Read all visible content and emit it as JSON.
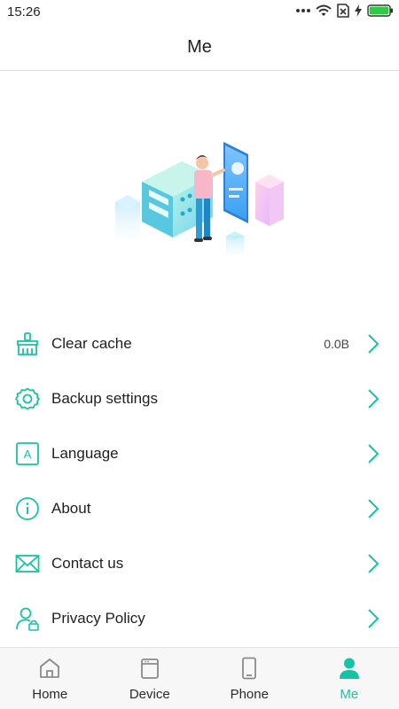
{
  "status_bar": {
    "time": "15:26",
    "icons": [
      "more-dots-icon",
      "wifi-icon",
      "sim-off-icon",
      "charging-icon",
      "battery-icon"
    ]
  },
  "header": {
    "title": "Me"
  },
  "colors": {
    "accent": "#17c3a5",
    "text": "#1f1f1f",
    "divider": "#dcdcdc",
    "nav_background": "#f7f7f7"
  },
  "menu": {
    "items": [
      {
        "label": "Clear cache",
        "value": "0.0B",
        "icon": "broom-icon"
      },
      {
        "label": "Backup settings",
        "icon": "gear-icon"
      },
      {
        "label": "Language",
        "icon": "language-icon",
        "icon_text": "A"
      },
      {
        "label": "About",
        "icon": "info-icon"
      },
      {
        "label": "Contact us",
        "icon": "mail-icon"
      },
      {
        "label": "Privacy Policy",
        "icon": "user-lock-icon"
      }
    ]
  },
  "bottom_nav": {
    "items": [
      {
        "label": "Home",
        "icon": "home-icon",
        "active": false
      },
      {
        "label": "Device",
        "icon": "device-icon",
        "active": false
      },
      {
        "label": "Phone",
        "icon": "phone-icon",
        "active": false
      },
      {
        "label": "Me",
        "icon": "person-icon",
        "active": true
      }
    ]
  }
}
